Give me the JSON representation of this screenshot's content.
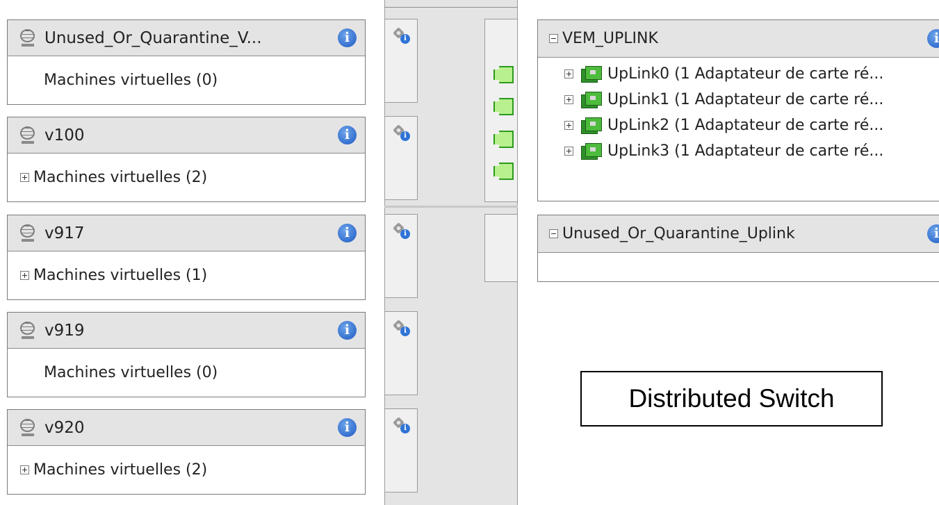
{
  "port_groups": [
    {
      "name": "Unused_Or_Quarantine_V...",
      "vm_label": "Machines virtuelles (0)",
      "expandable": false
    },
    {
      "name": "v100",
      "vm_label": "Machines virtuelles (2)",
      "expandable": true
    },
    {
      "name": "v917",
      "vm_label": "Machines virtuelles (1)",
      "expandable": true
    },
    {
      "name": "v919",
      "vm_label": "Machines virtuelles (0)",
      "expandable": false
    },
    {
      "name": "v920",
      "vm_label": "Machines virtuelles (2)",
      "expandable": true
    }
  ],
  "uplink_groups": [
    {
      "name": "VEM_UPLINK",
      "items": [
        "UpLink0 (1 Adaptateur de carte ré...",
        "UpLink1 (1 Adaptateur de carte ré...",
        "UpLink2 (1 Adaptateur de carte ré...",
        "UpLink3 (1 Adaptateur de carte ré..."
      ]
    },
    {
      "name": "Unused_Or_Quarantine_Uplink",
      "items": []
    }
  ],
  "caption": "Distributed Switch",
  "icons": {
    "port_group": "globe-icon",
    "info": "info-icon",
    "port": "port-settings-icon",
    "uplink": "network-adapter-icon",
    "uplink_port": "uplink-port-icon"
  },
  "colors": {
    "panel_header": "#e4e4e4",
    "info_blue": "#2f73d6",
    "uplink_green": "#2c9a1c"
  }
}
